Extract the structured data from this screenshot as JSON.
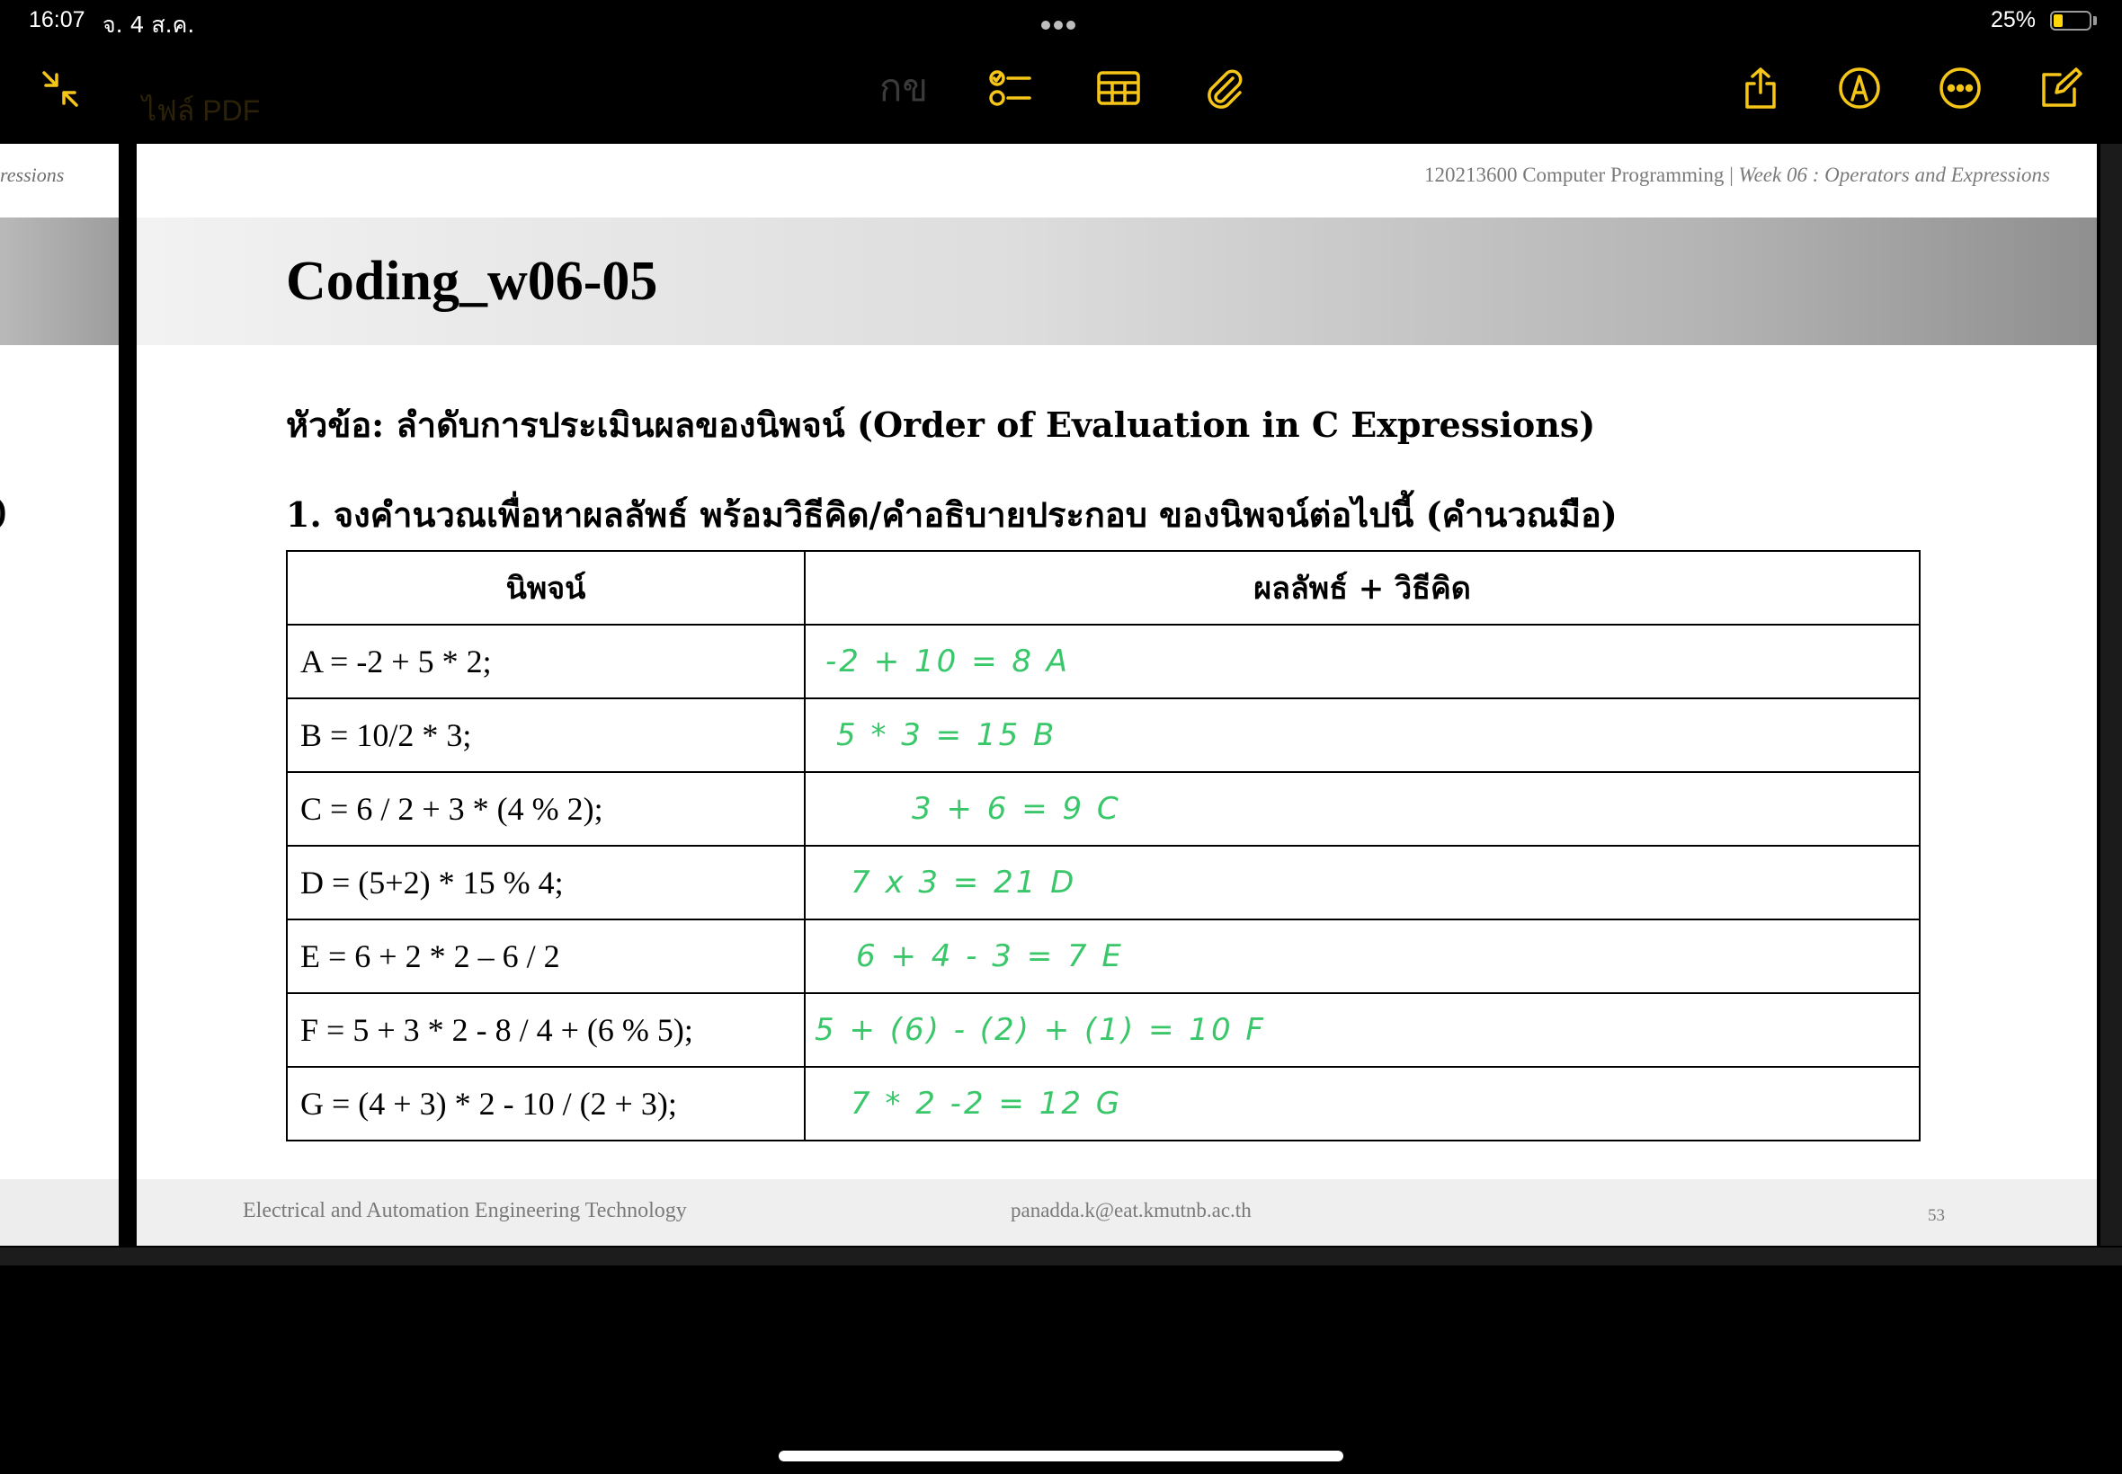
{
  "status_bar": {
    "time": "16:07",
    "date": "จ. 4 ส.ค.",
    "battery_percent": "25%",
    "battery_level": 0.25,
    "battery_color": "#ffd60a"
  },
  "toolbar": {
    "accent": "#f5c518",
    "title": "ไฟล์ PDF",
    "text_mode_label": "กข",
    "left_icons": [
      "collapse-icon"
    ],
    "center_icons": [
      "text-format-icon",
      "checklist-icon",
      "table-icon",
      "paperclip-icon"
    ],
    "right_icons": [
      "share-icon",
      "markup-pen-icon",
      "more-icon",
      "compose-icon"
    ]
  },
  "prev_page": {
    "header_fragment": "ressions",
    "paren_fragment": ")"
  },
  "slide": {
    "header_course": "120213600 Computer Programming",
    "header_sep": "|",
    "header_week": "Week 06 : Operators and Expressions",
    "title": "Coding_w06-05",
    "topic": "หัวข้อ: ลำดับการประเมินผลของนิพจน์ (Order of Evaluation in C Expressions)",
    "question": "1. จงคำนวณเพื่อหาผลลัพธ์ พร้อมวิธีคิด/คำอธิบายประกอบ ของนิพจน์ต่อไปนี้ (คำนวณมือ)",
    "table": {
      "headers": [
        "นิพจน์",
        "ผลลัพธ์ + วิธีคิด"
      ],
      "rows": [
        {
          "expression": "A = -2 + 5 * 2;",
          "answer": "-2 + 10 = 8 A"
        },
        {
          "expression": "B = 10/2 * 3;",
          "answer": "5 * 3 = 15 B"
        },
        {
          "expression": "C = 6 / 2 + 3 * (4 % 2);",
          "answer": "3 + 6 = 9 C"
        },
        {
          "expression": "D = (5+2) * 15 % 4;",
          "answer": "7 x 3 = 21 D"
        },
        {
          "expression": "E = 6 + 2 * 2 – 6 / 2",
          "answer": "6 + 4 - 3 = 7 E"
        },
        {
          "expression": "F = 5 + 3 * 2 - 8 / 4 + (6 % 5);",
          "answer": "5 + (6) - (2) + (1) = 10 F"
        },
        {
          "expression": "G = (4 + 3) * 2 - 10 / (2 + 3);",
          "answer": "7 * 2 -2 = 12 G"
        }
      ],
      "handwriting_color": "#39c76a"
    },
    "footer_left": "Electrical and Automation Engineering Technology",
    "footer_email": "panadda.k@eat.kmutnb.ac.th",
    "page_number": "53"
  }
}
